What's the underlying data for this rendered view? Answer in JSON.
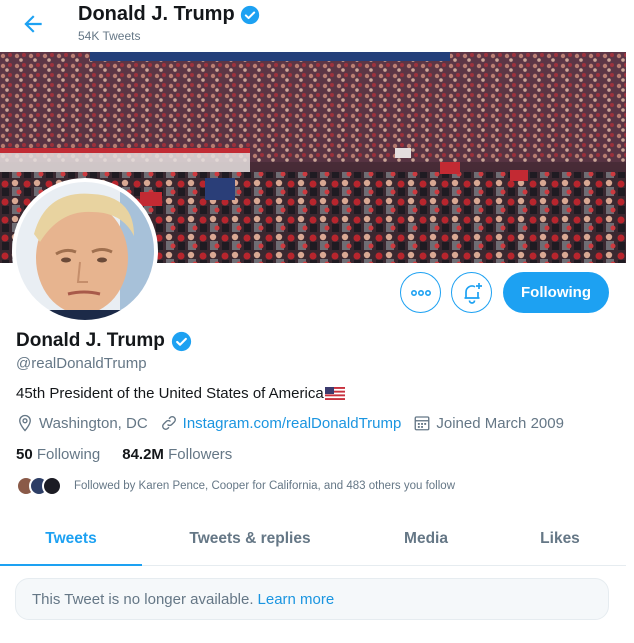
{
  "header": {
    "back_icon": "back-arrow-icon",
    "title": "Donald J. Trump",
    "tweet_count": "54K Tweets"
  },
  "profile": {
    "name": "Donald J. Trump",
    "verified_icon": "verified-badge-icon",
    "handle": "@realDonaldTrump",
    "bio": "45th President of the United States of America",
    "location": "Washington, DC",
    "website": "Instagram.com/realDonaldTrump",
    "joined": "Joined March 2009",
    "following_count": "50",
    "following_label": "Following",
    "followers_count": "84.2M",
    "followers_label": "Followers",
    "followed_by": "Followed by Karen Pence, Cooper for California, and 483 others you follow"
  },
  "actions": {
    "more_icon": "more-icon",
    "notify_icon": "bell-plus-icon",
    "follow_label": "Following"
  },
  "tabs": [
    {
      "label": "Tweets",
      "active": true
    },
    {
      "label": "Tweets & replies",
      "active": false
    },
    {
      "label": "Media",
      "active": false
    },
    {
      "label": "Likes",
      "active": false
    }
  ],
  "notice": {
    "text": "This Tweet is no longer available.",
    "link": "Learn more"
  },
  "colors": {
    "accent": "#1da1f2",
    "secondary_text": "#657786",
    "link": "#1b95e0"
  }
}
